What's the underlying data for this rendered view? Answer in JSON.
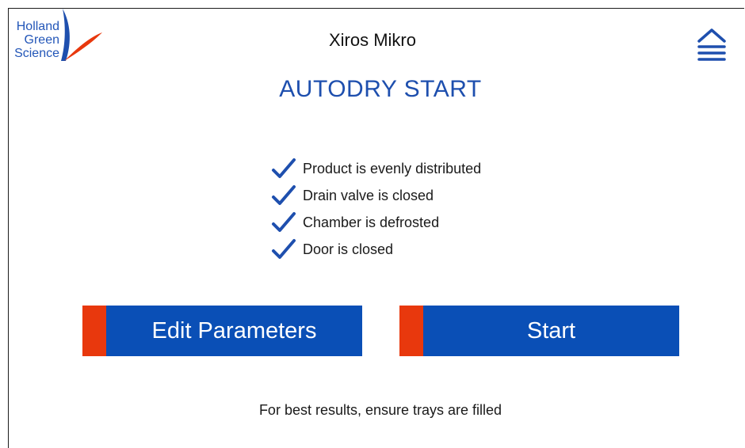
{
  "logo": {
    "lines": [
      "Holland",
      "Green",
      "Science"
    ],
    "colors": {
      "text": "#2356b8",
      "blue_sail": "#1e4fae",
      "orange_sail": "#e8380d"
    },
    "icon": "sail-logo-icon"
  },
  "header": {
    "app_title": "Xiros Mikro",
    "menu_icon": "home-menu-icon"
  },
  "page": {
    "title": "AUTODRY START"
  },
  "checklist": {
    "icon": "checkmark-icon",
    "items": [
      {
        "label": "Product is evenly distributed"
      },
      {
        "label": "Drain valve is closed"
      },
      {
        "label": "Chamber is defrosted"
      },
      {
        "label": "Door is closed"
      }
    ]
  },
  "buttons": {
    "edit_label": "Edit Parameters",
    "start_label": "Start"
  },
  "footer": {
    "note": "For best results, ensure trays are filled"
  },
  "colors": {
    "accent_blue": "#0a4fb6",
    "accent_orange": "#e8380d",
    "title_blue": "#1e4fae"
  }
}
